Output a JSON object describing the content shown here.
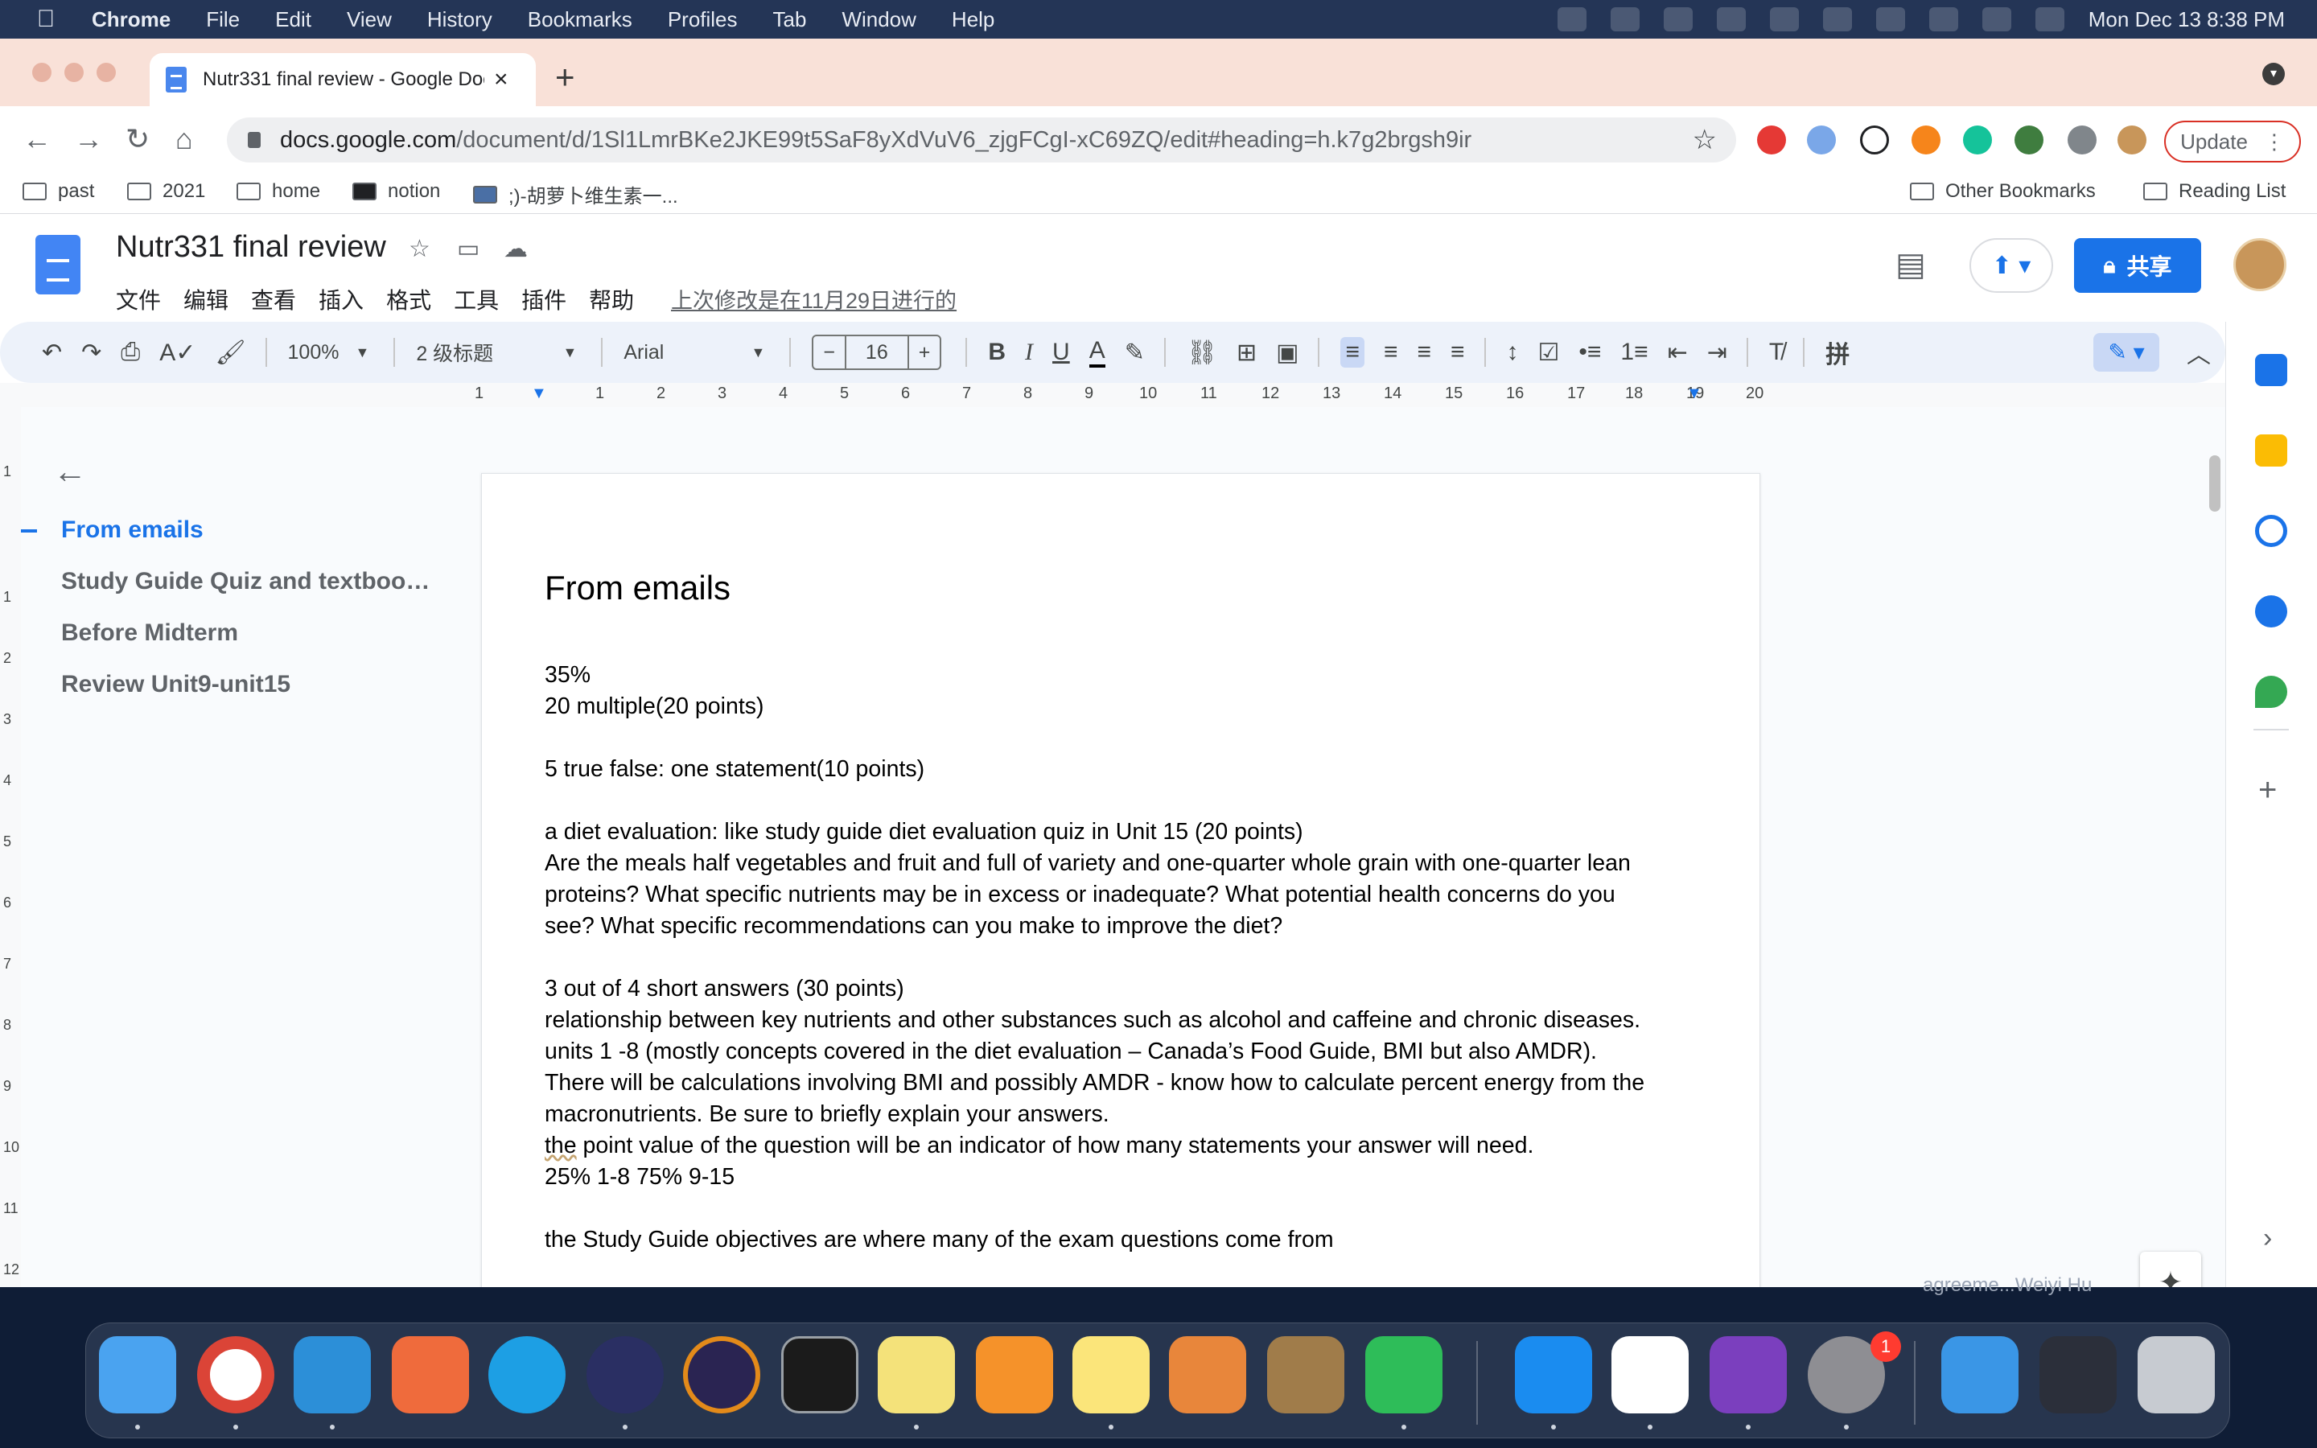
{
  "menubar": {
    "app": "Chrome",
    "items": [
      "File",
      "Edit",
      "View",
      "History",
      "Bookmarks",
      "Profiles",
      "Tab",
      "Window",
      "Help"
    ],
    "clock": "Mon Dec 13  8:38 PM"
  },
  "browser": {
    "tab_title": "Nutr331 final review - Google Docs",
    "tab_close": "×",
    "new_tab": "+",
    "url_domain": "docs.google.com",
    "url_path": "/document/d/1Sl1LmrBKe2JKE99t5SaF8yXdVuV6_zjgFCgI-xC69ZQ/edit#heading=h.k7g2brgsh9ir",
    "update_label": "Update",
    "bookmarks": [
      "past",
      "2021",
      "home",
      "notion",
      ";)-胡萝卜维生素一..."
    ],
    "other_bookmarks": "Other Bookmarks",
    "reading_list": "Reading List"
  },
  "docs": {
    "title": "Nutr331 final review",
    "menus": [
      "文件",
      "编辑",
      "查看",
      "插入",
      "格式",
      "工具",
      "插件",
      "帮助"
    ],
    "last_edit": "上次修改是在11月29日进行的",
    "share_label": "共享",
    "toolbar": {
      "zoom": "100%",
      "style": "2 级标题",
      "font": "Arial",
      "font_size": "16",
      "minus": "−",
      "plus": "+",
      "bold": "B",
      "italic": "I",
      "underline": "U",
      "text_color": "A",
      "input_tool": "拼"
    },
    "ruler_ticks": [
      "1",
      "1",
      "2",
      "3",
      "4",
      "5",
      "6",
      "7",
      "8",
      "9",
      "10",
      "11",
      "12",
      "13",
      "14",
      "15",
      "16",
      "17",
      "18",
      "19",
      "20"
    ],
    "vruler_ticks": [
      "1",
      "1",
      "2",
      "3",
      "4",
      "5",
      "6",
      "7",
      "8",
      "9",
      "10",
      "11",
      "12"
    ],
    "outline": [
      "From emails",
      "Study Guide Quiz and textboo…",
      "Before Midterm",
      "Review Unit9-unit15"
    ],
    "heading": "From emails",
    "lines": [
      "35%",
      "20 multiple(20 points)",
      "5 true false: one statement(10 points)",
      "a diet evaluation: like study guide diet evaluation quiz in Unit 15 (20 points)",
      "Are the meals half vegetables and fruit and full of variety and one-quarter whole grain with one-quarter lean",
      "proteins? What specific nutrients may be in excess or inadequate? What potential health concerns do you",
      "see? What specific recommendations can you make to improve the diet?",
      "3 out of 4 short answers (30 points)",
      "relationship between key nutrients and other substances such as alcohol and caffeine and chronic diseases.",
      "units 1 -8 (mostly concepts covered in the diet evaluation – Canada’s Food Guide, BMI but also AMDR).",
      "There will be calculations involving BMI and possibly AMDR - know how to calculate percent energy from the",
      "macronutrients. Be sure to briefly explain your answers.",
      "the",
      " point value of the question will be an indicator of how many statements your answer will need.",
      "25% 1-8 75% 9-15",
      "the Study Guide objectives are where many of the exam questions come from"
    ]
  },
  "dock": {
    "behind_text": "agreeme...Weiyi Hu",
    "badge": "1",
    "apps": [
      "finder",
      "chrome",
      "vscode",
      "postman",
      "docker",
      "reeder",
      "eclipse",
      "terminal",
      "stickies",
      "books",
      "notes",
      "bookmark",
      "sequel",
      "wechat",
      "app-store",
      "marginnote",
      "onenote",
      "system-preferences",
      "downloads",
      "screens",
      "trash"
    ]
  }
}
